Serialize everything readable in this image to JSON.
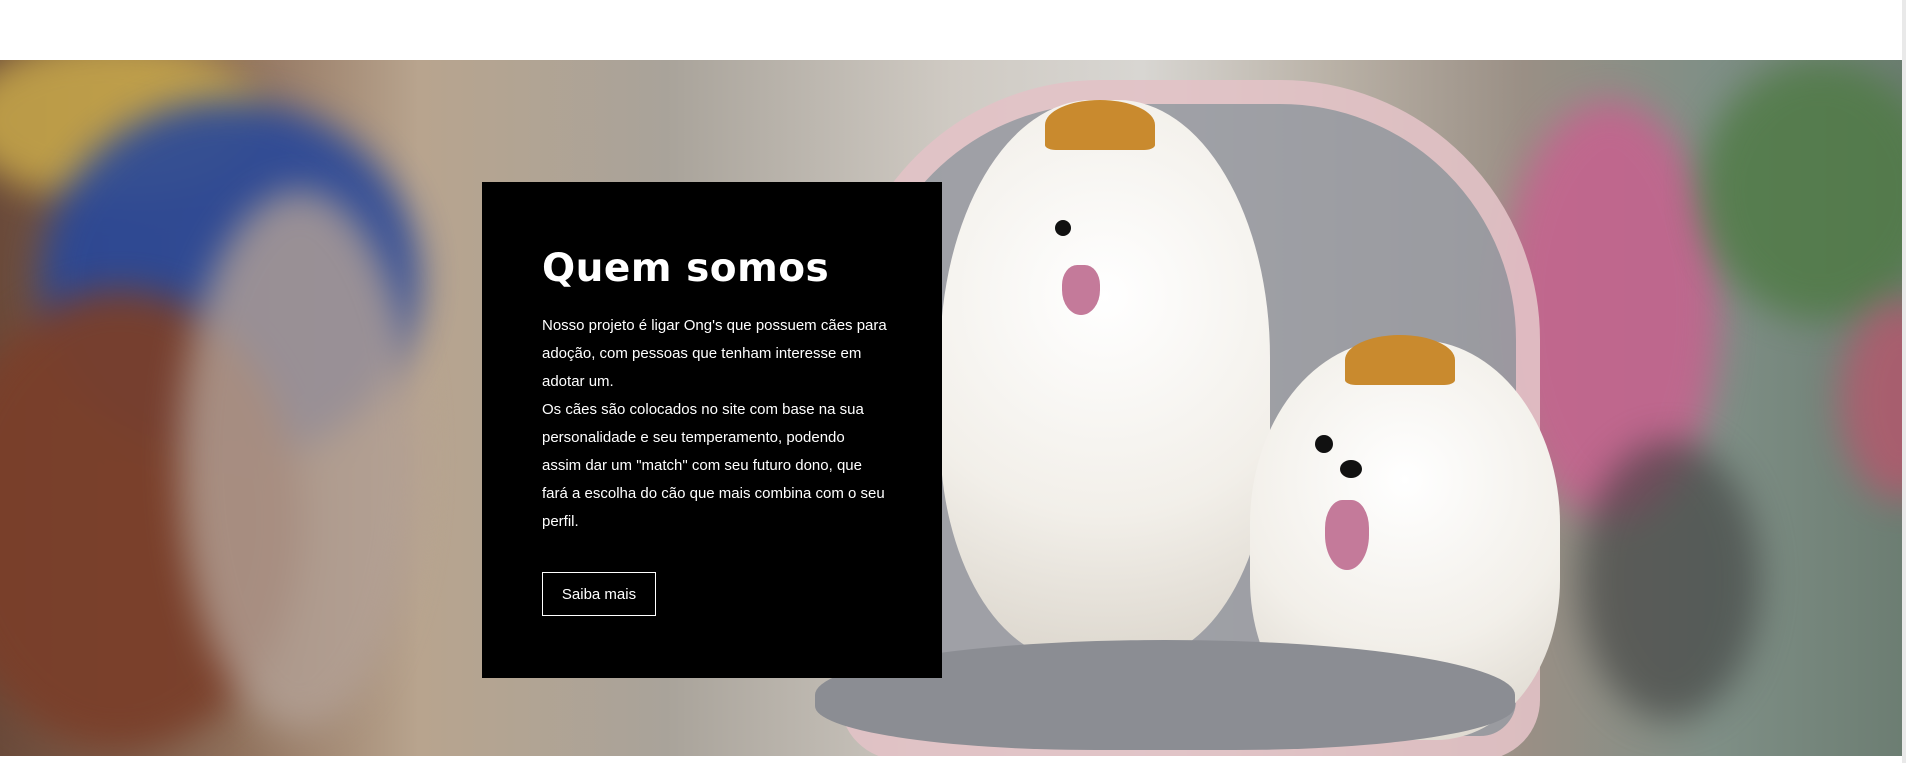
{
  "about": {
    "title": "Quem somos",
    "paragraph1": "Nosso projeto é ligar Ong's que possuem cães para adoção, com pessoas que tenham interesse em adotar um.",
    "paragraph2": "Os cães são colocados no site com base na sua personalidade e seu temperamento, podendo assim dar um \"match\" com seu futuro dono, que fará a escolha do cão que mais combina com o seu perfil.",
    "button_label": "Saiba mais"
  },
  "colors": {
    "card_background": "#000000",
    "text": "#ffffff",
    "page_background": "#ffffff"
  }
}
